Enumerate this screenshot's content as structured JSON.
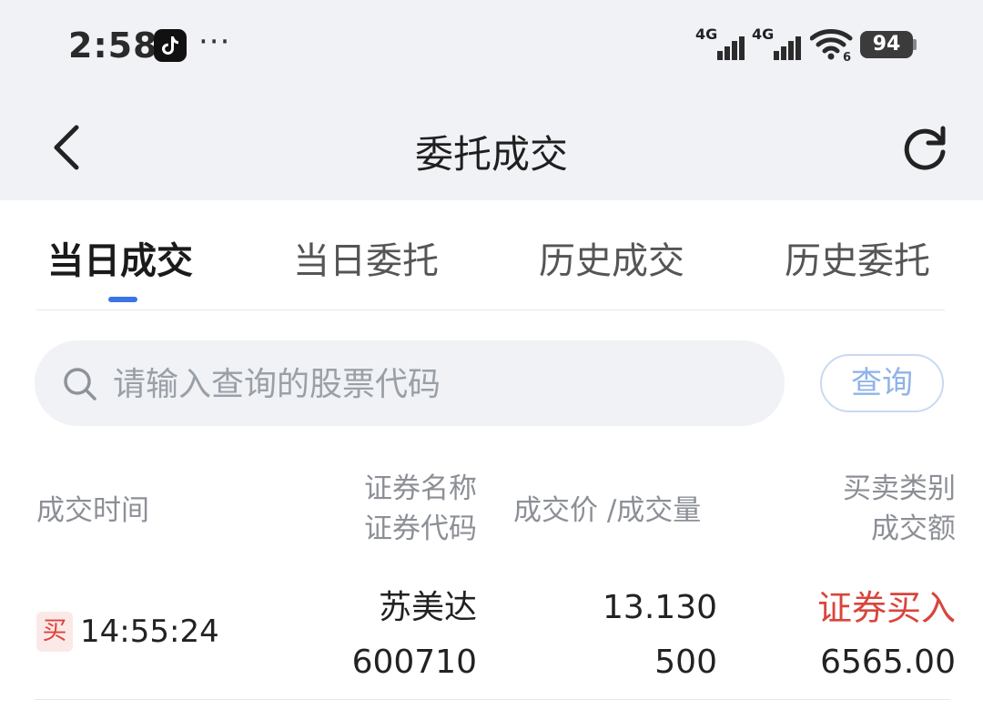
{
  "status_bar": {
    "time": "2:58",
    "more_dots": "···",
    "signal_1_label": "4G",
    "signal_2_label": "4G",
    "wifi_sub": "6",
    "battery": "94"
  },
  "header": {
    "title": "委托成交"
  },
  "tabs": [
    {
      "label": "当日成交",
      "active": true
    },
    {
      "label": "当日委托",
      "active": false
    },
    {
      "label": "历史成交",
      "active": false
    },
    {
      "label": "历史委托",
      "active": false
    }
  ],
  "search": {
    "placeholder": "请输入查询的股票代码",
    "value": "",
    "button_label": "查询"
  },
  "table": {
    "headers": {
      "time": "成交时间",
      "name": "证券名称",
      "code": "证券代码",
      "price_qty": "成交价 /成交量",
      "type": "买卖类别",
      "amount": "成交额"
    },
    "rows": [
      {
        "side_badge": "买",
        "time": "14:55:24",
        "name": "苏美达",
        "code": "600710",
        "price": "13.130",
        "quantity": "500",
        "type": "证券买入",
        "amount": "6565.00"
      }
    ]
  },
  "colors": {
    "accent": "#3a74e7",
    "buy_red": "#d9453c",
    "header_bg": "#f1f2f6"
  }
}
